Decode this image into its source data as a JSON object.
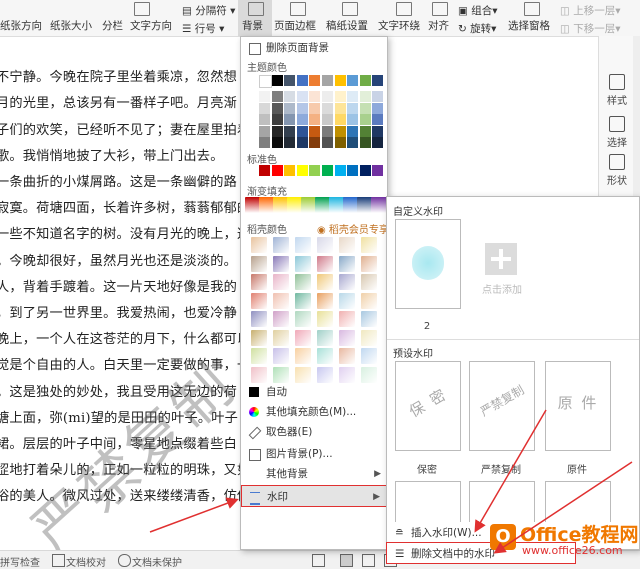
{
  "ribbon": {
    "row1": [
      "分隔符",
      "上移一层"
    ],
    "row2": [
      "行号",
      "下移一层"
    ],
    "buttons": [
      "纸张方向",
      "纸张大小",
      "分栏",
      "文字方向",
      "背景",
      "页面边框",
      "稿纸设置",
      "文字环绕",
      "对齐",
      "旋转",
      "选择窗格"
    ],
    "group": "组合"
  },
  "document": {
    "lines": [
      "",
      "不宁静。今晚在院子里坐着乘凉，忽然想",
      "月的光里，总该另有一番样子吧。月亮渐",
      "子们的欢笑，已经听不见了；妻在屋里拍着",
      "歌。我悄悄地披了大衫，带上门出去。",
      "一条曲折的小煤屑路。这是一条幽僻的路",
      "寂寞。荷塘四面，长着许多树，蓊蓊郁郁的",
      "一些不知道名字的树。没有月光的晚上，这",
      "。今晚却很好，虽然月光也还是淡淡的。",
      "人，背着手踱着。这一片天地好像是我的",
      "，到了另一世界里。我爱热闹，也爱冷静",
      "晚上，一个人在这苍茫的月下，什么都可以",
      "觉是个自由的人。白天里一定要做的事，一",
      "。这是独处的妙处，我且受用这无边的荷",
      "塘上面，弥(mi)望的是田田的叶子。叶子",
      "裙。层层的叶子中间，零星地点缀着些白",
      "涩地打着朵儿的，正如一粒粒的明珠，又如碧天里的星",
      "浴的美人。微风过处，送来缕缕清香，仿佛远处高楼上"
    ],
    "watermark": "严禁复制"
  },
  "right_pane": [
    "样式",
    "选择",
    "形状"
  ],
  "status": [
    "拼写检查",
    "文档校对",
    "文档未保护"
  ],
  "menu": {
    "items": {
      "delete_bg": "删除页面背景",
      "theme_colors": "主题颜色",
      "std_colors": "标准色",
      "gradient": "渐变填充",
      "shell_colors": "稻壳颜色",
      "shell_vip": "稻壳会员专享",
      "auto": "自动",
      "more_colors": "其他填充颜色(M)...",
      "eyedropper": "取色器(E)",
      "picture_bg": "图片背景(P)...",
      "other_bg": "其他背景",
      "watermark": "水印"
    },
    "theme_top": [
      "#ffffff",
      "#000000",
      "#44546a",
      "#4472c4",
      "#ed7d31",
      "#a5a5a5",
      "#ffc000",
      "#5b9bd5",
      "#70ad47",
      "#264478"
    ],
    "theme_shades": [
      [
        "#f2f2f2",
        "#7f7f7f",
        "#d6dce4",
        "#d9e2f3",
        "#fbe4d5",
        "#ededed",
        "#fff2cc",
        "#deebf6",
        "#e2efd9",
        "#c9d3e6"
      ],
      [
        "#d8d8d8",
        "#595959",
        "#adb9ca",
        "#b4c6e7",
        "#f7caac",
        "#dbdbdb",
        "#fee599",
        "#bdd7ee",
        "#c5e0b3",
        "#8ea9db"
      ],
      [
        "#bfbfbf",
        "#3f3f3f",
        "#8496b0",
        "#8eaadb",
        "#f4b183",
        "#c9c9c9",
        "#ffd965",
        "#9cc3e5",
        "#a8d08d",
        "#5b7bbf"
      ],
      [
        "#a5a5a5",
        "#262626",
        "#333f4f",
        "#2f5496",
        "#c55a11",
        "#7b7b7b",
        "#bf8f00",
        "#2e75b5",
        "#538135",
        "#1f3864"
      ],
      [
        "#7f7f7f",
        "#0c0c0c",
        "#222a35",
        "#1f3864",
        "#833c0b",
        "#525252",
        "#7f6000",
        "#1f4e79",
        "#375623",
        "#14243f"
      ]
    ],
    "standard": [
      "#c00000",
      "#ff0000",
      "#ffc000",
      "#ffff00",
      "#92d050",
      "#00b050",
      "#00b0f0",
      "#0070c0",
      "#002060",
      "#7030a0"
    ],
    "gradients": [
      "#c00000",
      "#ff6600",
      "#ffc000",
      "#ffee00",
      "#9ccc33",
      "#00a050",
      "#1cb5e0",
      "#2266cc",
      "#183c78",
      "#7030a0"
    ],
    "shell_grid": [
      [
        "#e8c39e",
        "#a0b4d6",
        "#c2d8ef",
        "#d8d8e8",
        "#e8d8c8",
        "#f0e0a0"
      ],
      [
        "#b7a08c",
        "#8a7ab8",
        "#8cc8d8",
        "#d07a8a",
        "#88a8c8",
        "#e0b090"
      ],
      [
        "#c8786a",
        "#e8b4c8",
        "#90c098",
        "#f0c878",
        "#a8a8d0",
        "#d8c8b0"
      ],
      [
        "#e08070",
        "#f0c0b0",
        "#70b8a0",
        "#e8a060",
        "#b8d8e8",
        "#f0d0a8"
      ],
      [
        "#9090c0",
        "#d0a0c8",
        "#b0d8c0",
        "#e8e098",
        "#f0b0b0",
        "#a8c8e0"
      ],
      [
        "#c8b070",
        "#e0d0a0",
        "#f0a8b8",
        "#a0d0c8",
        "#d8b8e0",
        "#f0e8c0"
      ],
      [
        "#d0e0a0",
        "#c8c0e8",
        "#f8d0a0",
        "#a8e0d8",
        "#e8b8a0",
        "#c0d8f0"
      ],
      [
        "#f0c0c8",
        "#b0e0b8",
        "#f8e0b0",
        "#c8c8f0",
        "#e0d0f0",
        "#d8f0e0"
      ]
    ]
  },
  "watermark_menu": {
    "custom_title": "自定义水印",
    "custom_item": "2",
    "add_label": "点击添加",
    "preset_title": "预设水印",
    "presets": [
      {
        "label": "保密",
        "text": "保 密"
      },
      {
        "label": "严禁复制",
        "text": "严禁复制"
      },
      {
        "label": "原件",
        "text": "原 件"
      }
    ],
    "insert": "插入水印(W)...",
    "delete": "删除文档中的水印"
  },
  "logo": {
    "brand": "Office教程网",
    "url": "www.office26.com"
  },
  "colors": {
    "accent": "#e03030",
    "logo_orange": "#f07800"
  }
}
